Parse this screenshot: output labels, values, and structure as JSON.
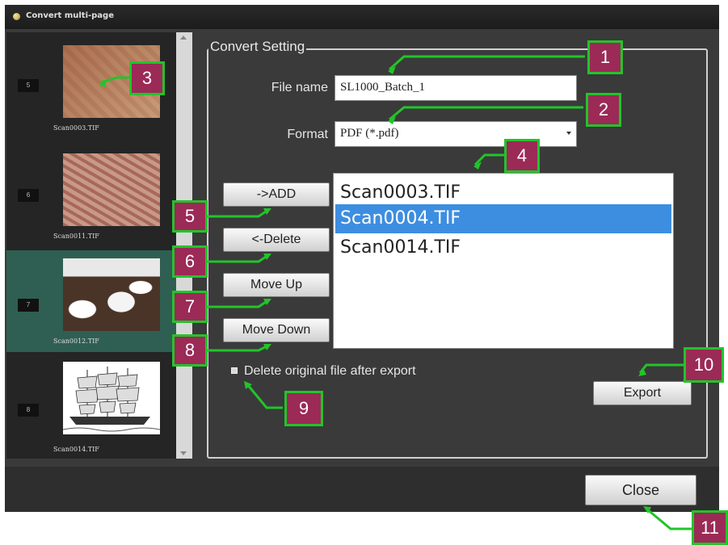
{
  "window": {
    "title": "Convert multi-page"
  },
  "thumbnails": [
    {
      "number": "5",
      "filename": "Scan0003.TIF",
      "image": "map-scan",
      "selected": false
    },
    {
      "number": "6",
      "filename": "Scan0011.TIF",
      "image": "map-scan-red",
      "selected": false
    },
    {
      "number": "7",
      "filename": "Scan0012.TIF",
      "image": "mountain-photo",
      "selected": true
    },
    {
      "number": "8",
      "filename": "Scan0014.TIF",
      "image": "sailing-ship-drawing",
      "selected": false
    }
  ],
  "settings": {
    "group_title": "Convert Setting",
    "file_name_label": "File name",
    "file_name_value": "SL1000_Batch_1",
    "format_label": "Format",
    "format_value": "PDF (*.pdf)"
  },
  "buttons": {
    "add": "->ADD",
    "delete": "<-Delete",
    "move_up": "Move Up",
    "move_down": "Move Down",
    "export": "Export",
    "close": "Close"
  },
  "file_list": [
    {
      "name": "Scan0003.TIF",
      "selected": false
    },
    {
      "name": "Scan0004.TIF",
      "selected": true
    },
    {
      "name": "Scan0014.TIF",
      "selected": false
    }
  ],
  "delete_original": {
    "label": "Delete original file after export",
    "checked": false
  },
  "callouts": [
    "1",
    "2",
    "3",
    "4",
    "5",
    "6",
    "7",
    "8",
    "9",
    "10",
    "11"
  ],
  "colors": {
    "callout_fill": "#9b2a57",
    "callout_border": "#22c42a",
    "selection": "#3d8ee0",
    "thumb_selected": "#2f5f52"
  }
}
